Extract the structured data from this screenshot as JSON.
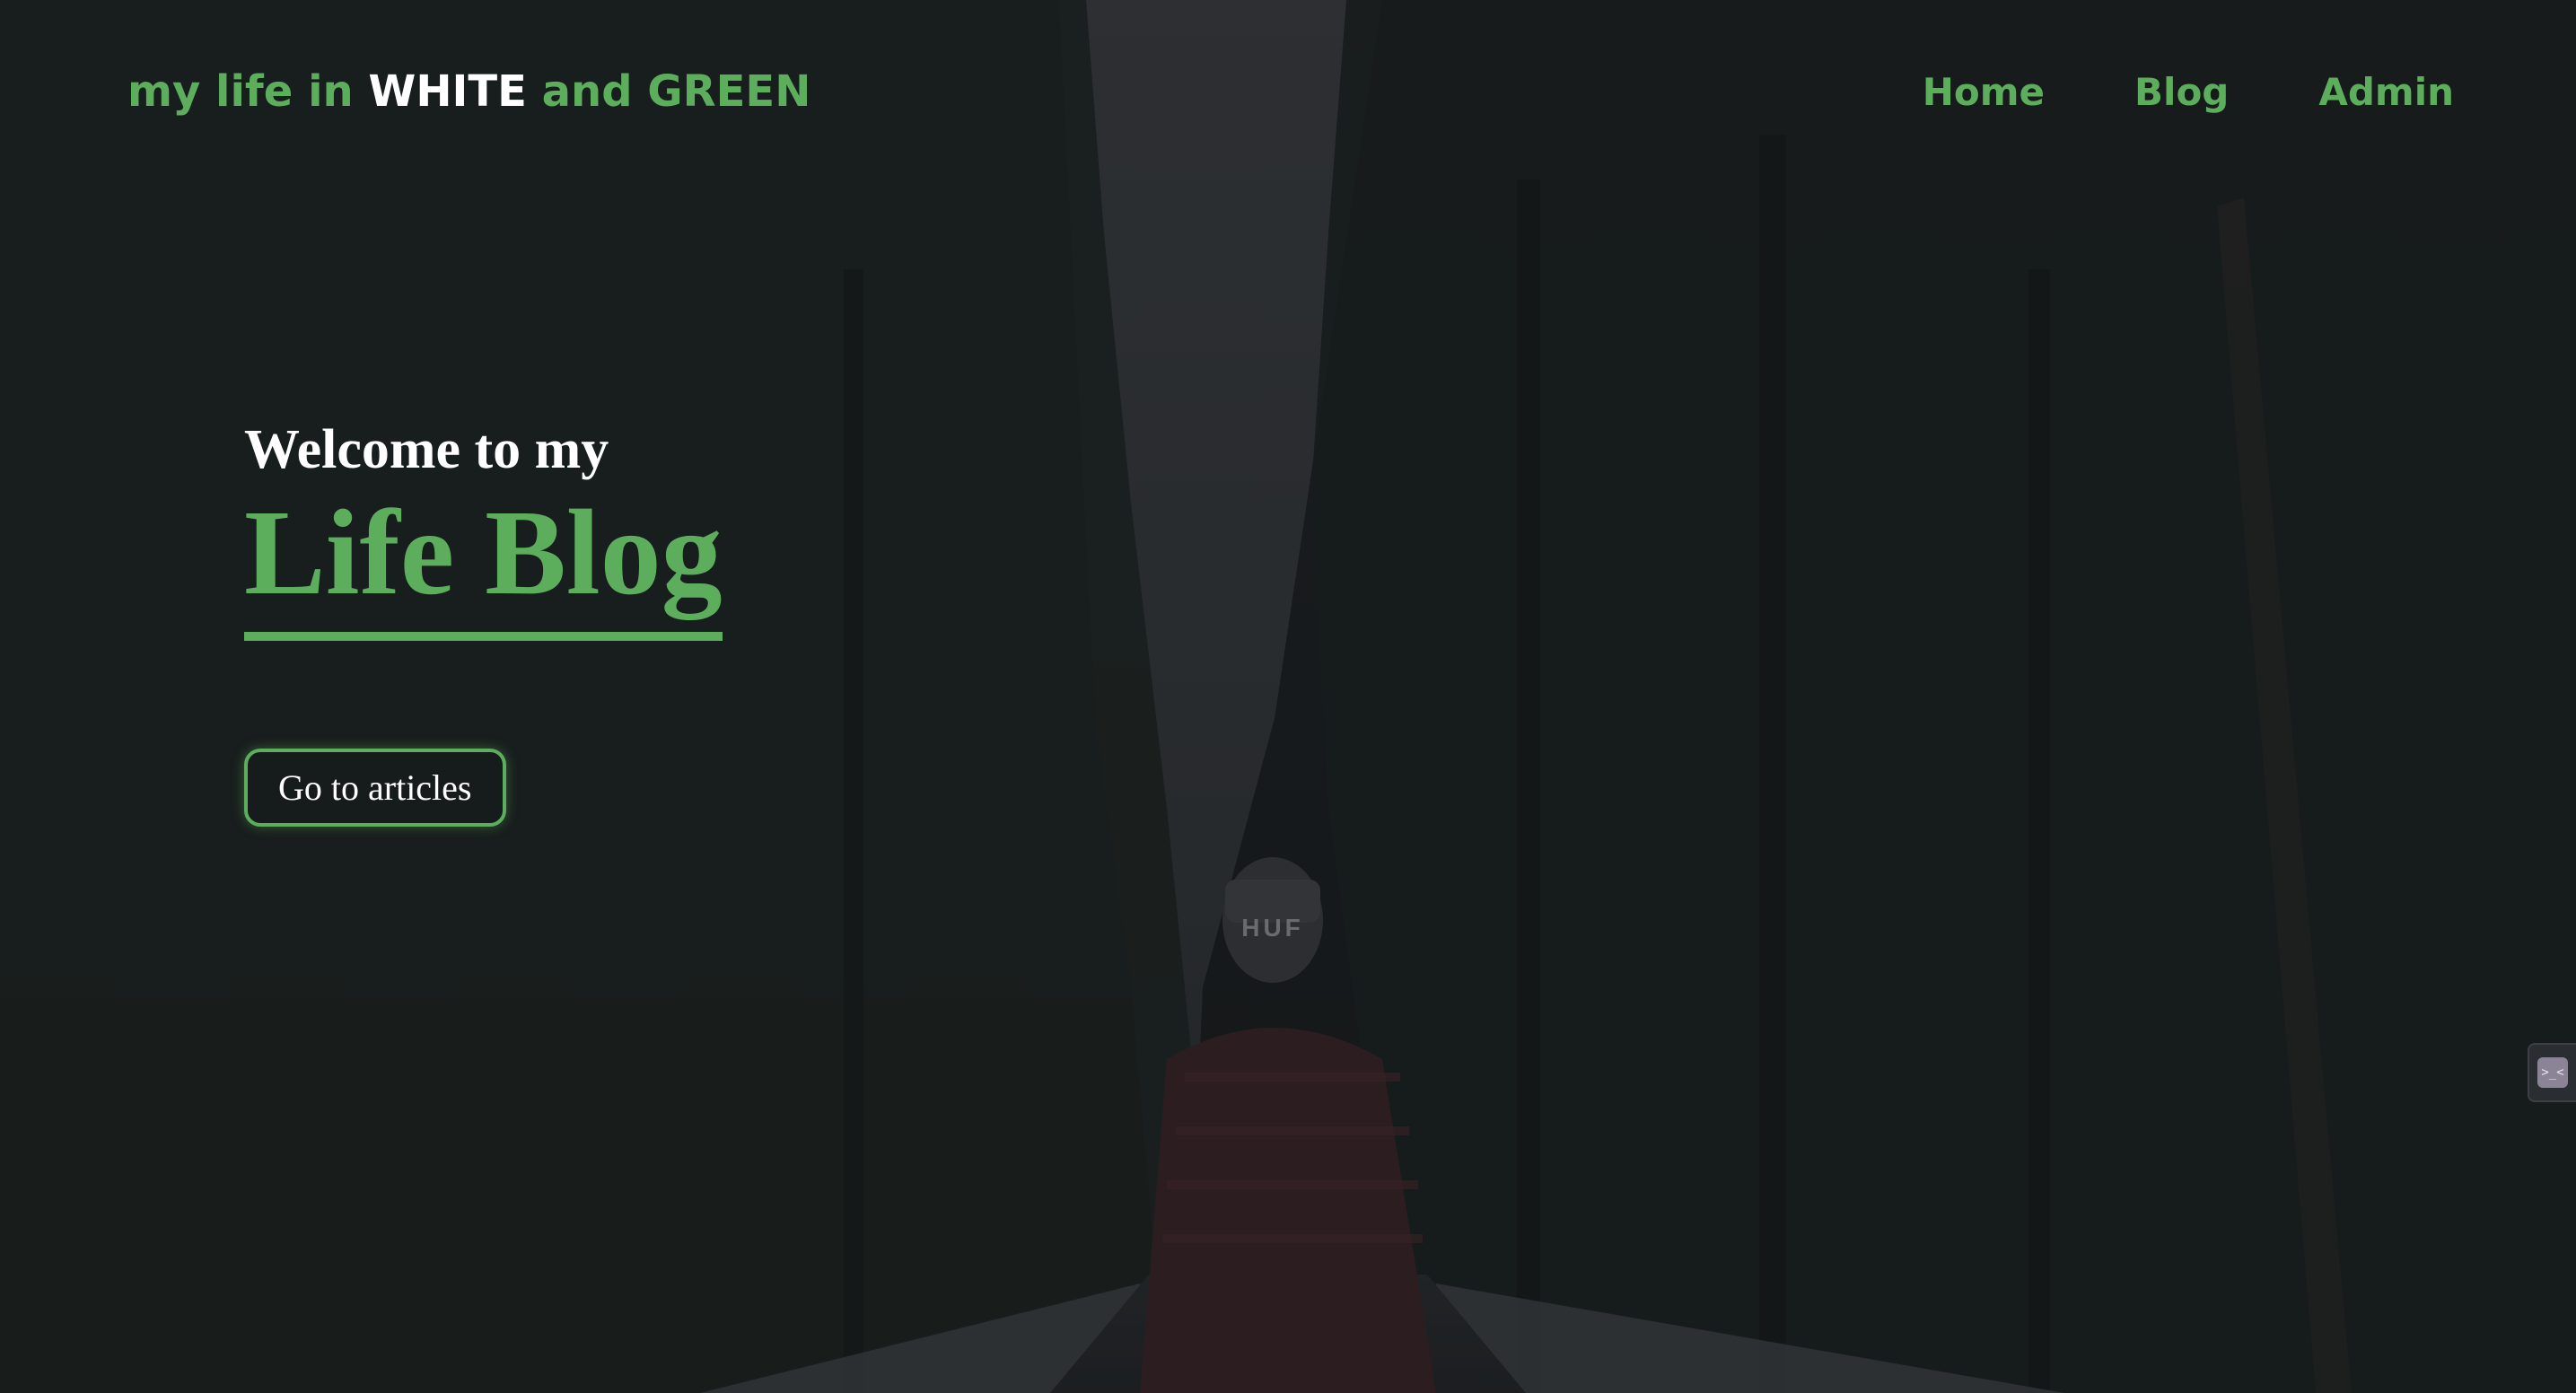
{
  "header": {
    "brand": {
      "part1": "my life in ",
      "part2": "WHITE",
      "part3": " and GREEN"
    },
    "nav": [
      {
        "label": "Home"
      },
      {
        "label": "Blog"
      },
      {
        "label": "Admin"
      }
    ]
  },
  "hero": {
    "subtitle": "Welcome to my",
    "title": "Life Blog",
    "cta_label": "Go to articles"
  },
  "side_widget": {
    "icon": "chat-widget-icon",
    "glyph": ">_<"
  },
  "colors": {
    "accent": "#5cae5c",
    "text": "#ffffff",
    "background": "#1c1f21"
  }
}
